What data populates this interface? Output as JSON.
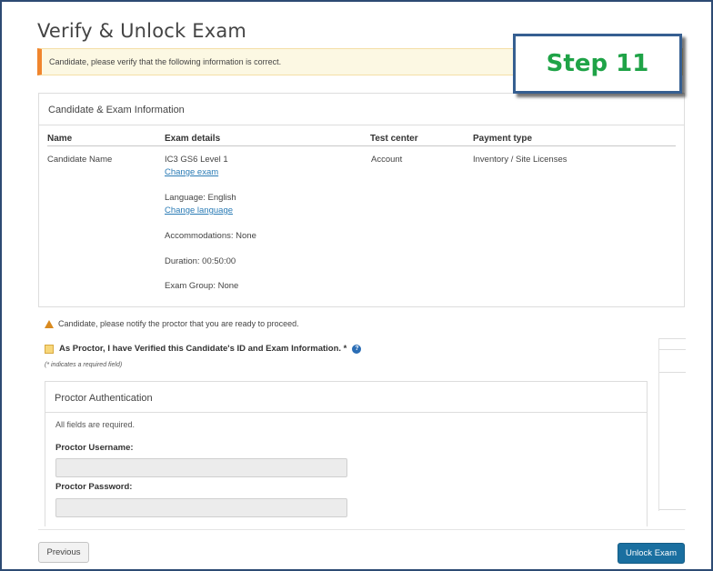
{
  "page": {
    "title": "Verify & Unlock Exam",
    "step_badge": "Step 11"
  },
  "alert": {
    "text": "Candidate, please verify that the following information is correct."
  },
  "info_card": {
    "heading": "Candidate & Exam Information",
    "columns": [
      "Name",
      "Exam details",
      "Test center",
      "Payment type"
    ],
    "candidate_name": "Candidate Name",
    "exam": "IC3 GS6 Level 1",
    "change_exam": "Change exam",
    "language": "Language: English",
    "change_language": "Change language",
    "accommodations": "Accommodations: None",
    "duration": "Duration: 00:50:00",
    "exam_group": "Exam Group: None",
    "test_center": "Account",
    "payment_type": "Inventory / Site Licenses"
  },
  "notice": {
    "text": "Candidate, please notify the proctor that you are ready to proceed.",
    "icon": "warning-icon"
  },
  "verify": {
    "label": "As Proctor, I have Verified this Candidate's ID and Exam Information. *",
    "help_glyph": "?",
    "required_note": "(* indicates a required field)"
  },
  "auth": {
    "heading": "Proctor Authentication",
    "all_required": "All fields are required.",
    "username_label": "Proctor Username:",
    "username_value": "",
    "password_label": "Proctor Password:",
    "password_value": ""
  },
  "footer": {
    "previous_label": "Previous",
    "unlock_label": "Unlock Exam"
  },
  "colors": {
    "accent_blue": "#1a6fa0",
    "alert_orange": "#f0852e",
    "step_green": "#1fa347",
    "step_border": "#365f91"
  }
}
